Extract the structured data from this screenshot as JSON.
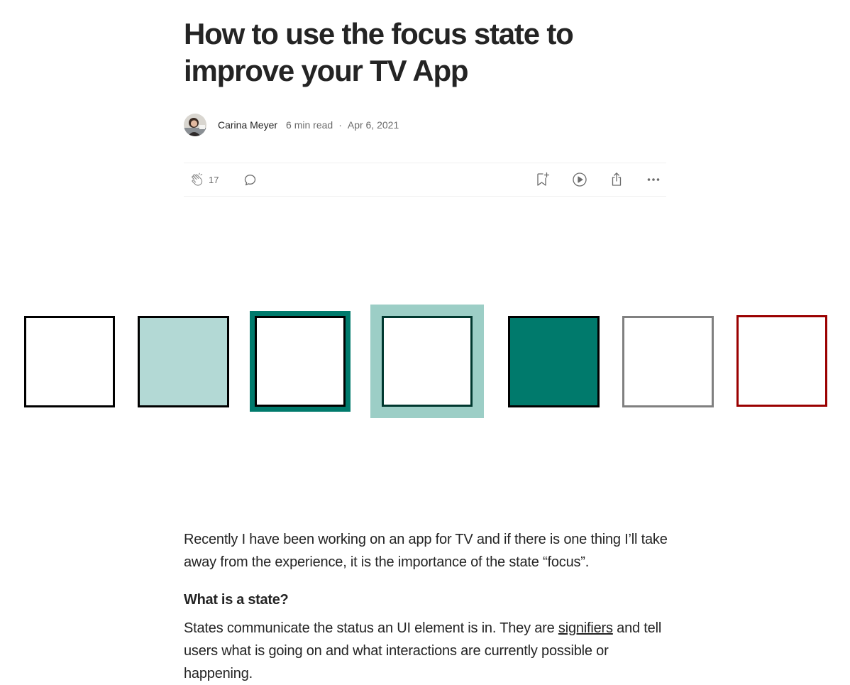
{
  "article": {
    "title": "How to use the focus state to improve your TV App",
    "author": "Carina Meyer",
    "read_time": "6 min read",
    "separator": "·",
    "date": "Apr 6, 2021"
  },
  "actions": {
    "clap_count": "17",
    "icons": [
      "clap-icon",
      "comment-icon",
      "bookmark-add-icon",
      "play-icon",
      "share-icon",
      "more-icon"
    ]
  },
  "figure": {
    "states": [
      {
        "state": "default",
        "fill": "#ffffff",
        "border": "#000000"
      },
      {
        "state": "hover",
        "fill": "#b3d9d5",
        "border": "#000000"
      },
      {
        "state": "focus",
        "fill": "#ffffff",
        "border": "#000000",
        "ring": "#007a6c"
      },
      {
        "state": "focus-light",
        "fill": "#ffffff",
        "border": "#00382f",
        "ring": "#9ccec6"
      },
      {
        "state": "active",
        "fill": "#007a6c",
        "border": "#000000"
      },
      {
        "state": "disabled",
        "fill": "#ffffff",
        "border": "#808080"
      },
      {
        "state": "error",
        "fill": "#ffffff",
        "border": "#9a0000"
      }
    ]
  },
  "body": {
    "p1": "Recently I have been working on an app for TV and if there is one thing I’ll take away from the experience, it is the importance of the state “focus”.",
    "heading": "What is a state?",
    "p2_before": "States communicate the status an UI element is in. They are ",
    "p2_link": "signifiers",
    "p2_after": " and tell users what is going on and what interactions are currently possible or happening."
  },
  "colors": {
    "text": "#242424",
    "muted": "#6b6b6b",
    "teal": "#007a6c",
    "teal_light": "#b3d9d5",
    "red": "#9a0000"
  }
}
